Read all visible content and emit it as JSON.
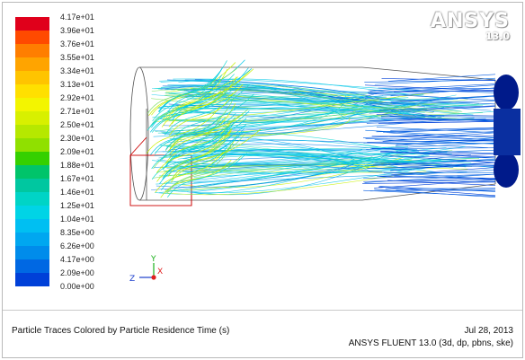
{
  "legend": {
    "labels": [
      "4.17e+01",
      "3.96e+01",
      "3.76e+01",
      "3.55e+01",
      "3.34e+01",
      "3.13e+01",
      "2.92e+01",
      "2.71e+01",
      "2.50e+01",
      "2.30e+01",
      "2.09e+01",
      "1.88e+01",
      "1.67e+01",
      "1.46e+01",
      "1.25e+01",
      "1.04e+01",
      "8.35e+00",
      "6.26e+00",
      "4.17e+00",
      "2.09e+00",
      "0.00e+00"
    ],
    "colors": [
      "#e0001b",
      "#ff4a00",
      "#ff7e00",
      "#ffa400",
      "#ffc400",
      "#ffe000",
      "#f3f500",
      "#d8f000",
      "#b6e800",
      "#90e000",
      "#35d000",
      "#00c46a",
      "#00c7a0",
      "#00d4c6",
      "#00d4e6",
      "#00bff2",
      "#00a7f0",
      "#008ceb",
      "#0068e3",
      "#0040d8"
    ]
  },
  "logo": {
    "word": "ANSYS",
    "version": "13.0"
  },
  "axes": {
    "y": "Y",
    "z": "Z",
    "x": "X"
  },
  "footer": {
    "title": "Particle Traces Colored by Particle Residence Time (s)",
    "date": "Jul 28, 2013",
    "solver": "ANSYS FLUENT 13.0 (3d, dp, pbns, ske)"
  }
}
